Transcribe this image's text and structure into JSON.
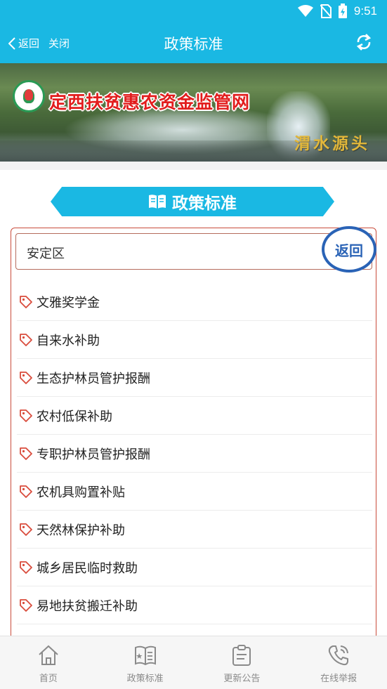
{
  "status_bar": {
    "time": "9:51",
    "icons": [
      "wifi-icon",
      "no-sim-icon",
      "battery-icon"
    ]
  },
  "nav": {
    "back_label": "返回",
    "close_label": "关闭",
    "title": "政策标准",
    "refresh_icon": "refresh-icon"
  },
  "banner": {
    "title": "定西扶贫惠农资金监管网",
    "caption": "渭水源头"
  },
  "section": {
    "title": "政策标准",
    "icon": "book-icon"
  },
  "filter": {
    "selected": "安定区",
    "back_button": "返回"
  },
  "policies": [
    {
      "label": "文雅奖学金"
    },
    {
      "label": "自来水补助"
    },
    {
      "label": "生态护林员管护报酬"
    },
    {
      "label": "农村低保补助"
    },
    {
      "label": "专职护林员管护报酬"
    },
    {
      "label": "农机具购置补贴"
    },
    {
      "label": "天然林保护补助"
    },
    {
      "label": "城乡居民临时救助"
    },
    {
      "label": "易地扶贫搬迁补助"
    }
  ],
  "tabbar": {
    "items": [
      {
        "label": "首页",
        "icon": "home-icon"
      },
      {
        "label": "政策标准",
        "icon": "policy-book-icon"
      },
      {
        "label": "更新公告",
        "icon": "clipboard-icon"
      },
      {
        "label": "在线举报",
        "icon": "phone-icon"
      }
    ]
  },
  "colors": {
    "primary": "#1ab8e3",
    "panel_border": "#c94c3b",
    "back_button": "#2a63b6",
    "tag_icon": "#d94c3c",
    "banner_title": "#e21d1d",
    "banner_caption": "#e2b73a"
  }
}
